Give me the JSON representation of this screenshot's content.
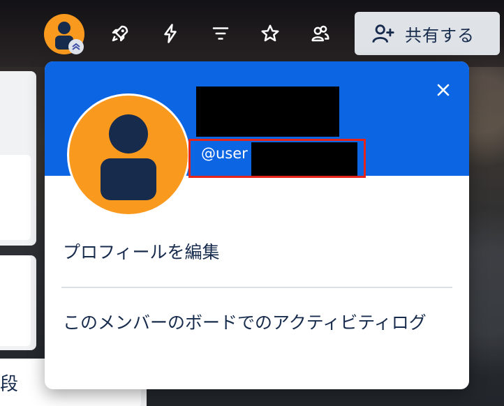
{
  "header": {
    "share_label": "共有する",
    "icons": [
      "rocket-icon",
      "lightning-icon",
      "filter-icon",
      "star-icon",
      "team-icon"
    ]
  },
  "board": {
    "partial_text": "段"
  },
  "profile_popover": {
    "username_prefix": "@user",
    "menu": {
      "edit_profile": "プロフィールを編集",
      "member_activity": "このメンバーのボードでのアクティビティログ"
    }
  },
  "colors": {
    "header_blue": "#0c66e4",
    "avatar_orange": "#f99a1f",
    "avatar_figure": "#172b4d",
    "highlight_red": "#e5241a"
  }
}
